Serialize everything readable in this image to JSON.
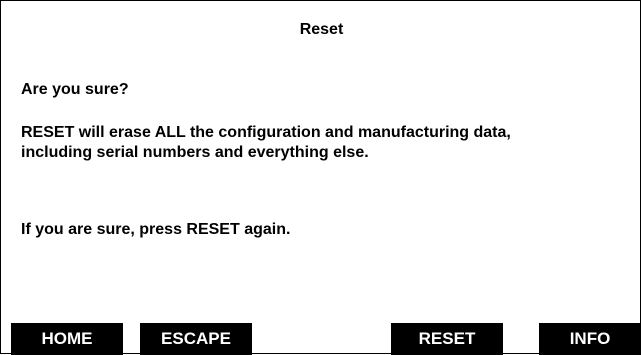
{
  "dialog": {
    "title": "Reset",
    "question": "Are you sure?",
    "message": "RESET will erase ALL the configuration and manufacturing data, including serial numbers and everything else.",
    "confirm": "If you are sure, press RESET again."
  },
  "softkeys": {
    "home": "HOME",
    "escape": "ESCAPE",
    "reset": "RESET",
    "info": "INFO"
  },
  "colors": {
    "background": "#ffffff",
    "text": "#000000",
    "softkey_bg": "#000000",
    "softkey_text": "#ffffff"
  }
}
